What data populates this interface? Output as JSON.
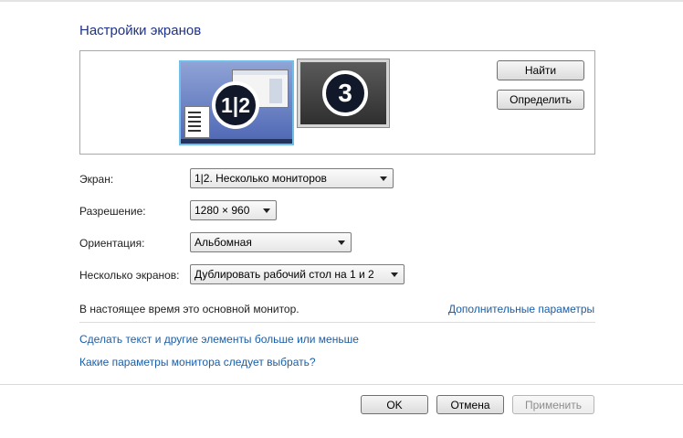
{
  "title": "Настройки экранов",
  "preview": {
    "monitor_primary_label": "1|2",
    "monitor_secondary_label": "3",
    "find_button": "Найти",
    "identify_button": "Определить"
  },
  "fields": {
    "screen": {
      "label": "Экран:",
      "value": "1|2. Несколько мониторов"
    },
    "resolution": {
      "label": "Разрешение:",
      "value": "1280 × 960"
    },
    "orientation": {
      "label": "Ориентация:",
      "value": "Альбомная"
    },
    "multiple": {
      "label": "Несколько экранов:",
      "value": "Дублировать рабочий стол на 1 и 2"
    }
  },
  "status": "В настоящее время это основной монитор.",
  "links": {
    "advanced": "Дополнительные параметры",
    "text_size": "Сделать текст и другие элементы больше или меньше",
    "which_settings": "Какие параметры монитора следует выбрать?"
  },
  "footer": {
    "ok": "OK",
    "cancel": "Отмена",
    "apply": "Применить"
  }
}
